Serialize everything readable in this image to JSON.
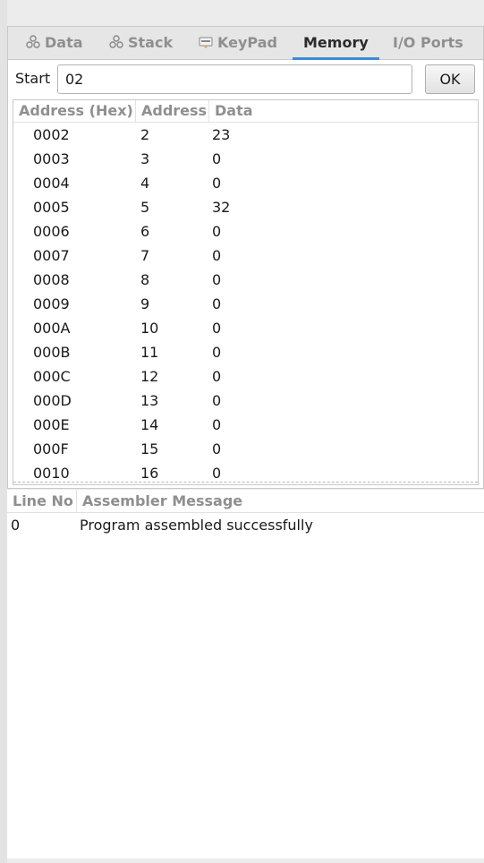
{
  "tabs": [
    {
      "label": "Data",
      "icon": "data-icon",
      "active": false
    },
    {
      "label": "Stack",
      "icon": "stack-icon",
      "active": false
    },
    {
      "label": "KeyPad",
      "icon": "keypad-icon",
      "active": false
    },
    {
      "label": "Memory",
      "icon": "",
      "active": true
    },
    {
      "label": "I/O Ports",
      "icon": "",
      "active": false
    }
  ],
  "memory": {
    "start_label": "Start",
    "start_value": "02",
    "ok_label": "OK",
    "columns": [
      "Address (Hex)",
      "Address",
      "Data"
    ],
    "rows": [
      [
        "0002",
        "2",
        "23"
      ],
      [
        "0003",
        "3",
        "0"
      ],
      [
        "0004",
        "4",
        "0"
      ],
      [
        "0005",
        "5",
        "32"
      ],
      [
        "0006",
        "6",
        "0"
      ],
      [
        "0007",
        "7",
        "0"
      ],
      [
        "0008",
        "8",
        "0"
      ],
      [
        "0009",
        "9",
        "0"
      ],
      [
        "000A",
        "10",
        "0"
      ],
      [
        "000B",
        "11",
        "0"
      ],
      [
        "000C",
        "12",
        "0"
      ],
      [
        "000D",
        "13",
        "0"
      ],
      [
        "000E",
        "14",
        "0"
      ],
      [
        "000F",
        "15",
        "0"
      ],
      [
        "0010",
        "16",
        "0"
      ]
    ]
  },
  "messages": {
    "columns": [
      "Line No",
      "Assembler Message"
    ],
    "rows": [
      [
        "0",
        "Program assembled successfully"
      ]
    ]
  },
  "colors": {
    "accent": "#3d8bd4",
    "header_text": "#8f8f8f",
    "tabbar_bg": "#e6e6e6"
  }
}
